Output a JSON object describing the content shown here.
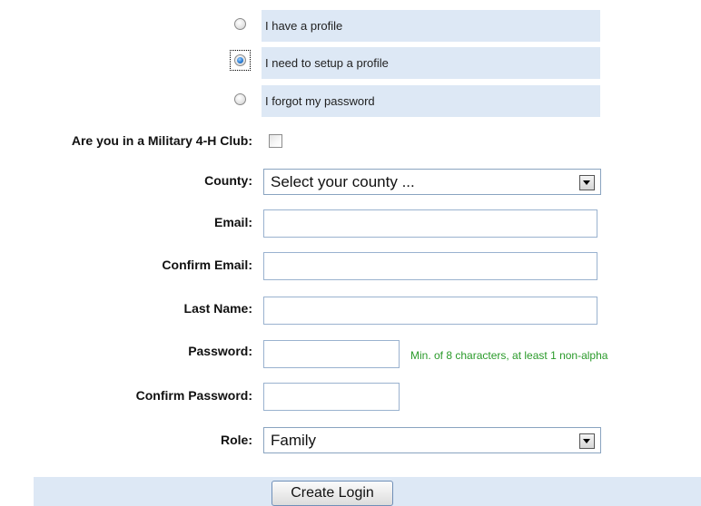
{
  "profile_options": [
    {
      "label": "I have a profile",
      "checked": false
    },
    {
      "label": "I need to setup a profile",
      "checked": true
    },
    {
      "label": "I forgot my password",
      "checked": false
    }
  ],
  "form": {
    "military_label": "Are you in a Military 4-H Club:",
    "military_checked": false,
    "county_label": "County:",
    "county_value": "Select your county ...",
    "email_label": "Email:",
    "email_value": "",
    "confirm_email_label": "Confirm Email:",
    "confirm_email_value": "",
    "last_name_label": "Last Name:",
    "last_name_value": "",
    "password_label": "Password:",
    "password_value": "",
    "password_hint": "Min. of 8 characters, at least 1 non-alpha",
    "confirm_password_label": "Confirm Password:",
    "confirm_password_value": "",
    "role_label": "Role:",
    "role_value": "Family"
  },
  "actions": {
    "create_login_label": "Create Login"
  },
  "colors": {
    "panel_background": "#dde8f5",
    "hint_text": "#2a9a2a",
    "selected_radio": "#2b7fd6"
  },
  "icons": {
    "radio": "radio-button",
    "checkbox": "checkbox",
    "dropdown": "chevron-down-icon"
  }
}
